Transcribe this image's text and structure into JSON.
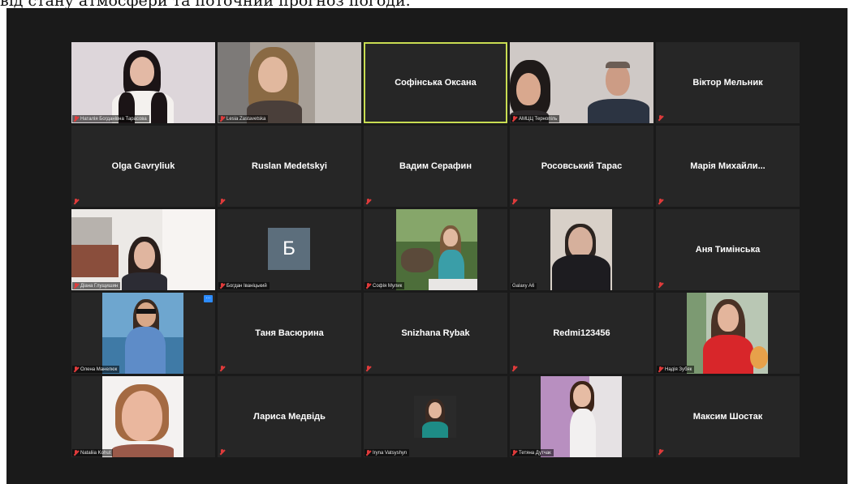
{
  "header_text": "від стану атмосфери та поточний прогноз погоди.",
  "colors": {
    "tile_bg": "#262626",
    "active_speaker_border": "#c8dc52",
    "muted_mic": "#e03b3b"
  },
  "tiles": [
    {
      "name": "Наталія Богданівна Тарасова",
      "type": "video"
    },
    {
      "name": "Lesia Zastavetska",
      "type": "video"
    },
    {
      "name": "Софінська Оксана",
      "type": "name",
      "speaking": true
    },
    {
      "name": "АМЦЦ Тернопіль",
      "type": "video"
    },
    {
      "name": "Віктор Мельник",
      "type": "name"
    },
    {
      "name": "Olga Gavryliuk",
      "type": "name"
    },
    {
      "name": "Ruslan Medetskyi",
      "type": "name"
    },
    {
      "name": "Вадим Серафин",
      "type": "name"
    },
    {
      "name": "Росовський Тарас",
      "type": "name"
    },
    {
      "name": "Марія Михайли...",
      "type": "name"
    },
    {
      "name": "Діана Глущишин",
      "type": "video"
    },
    {
      "name": "Богдан Іваніцький",
      "type": "avatar",
      "initial": "Б"
    },
    {
      "name": "Софія Мулик",
      "type": "photo"
    },
    {
      "name": "Galaxy A6",
      "type": "video"
    },
    {
      "name": "Аня Тимінська",
      "type": "name"
    },
    {
      "name": "Олена Манелюк",
      "type": "photo"
    },
    {
      "name": "Таня Васюрина",
      "type": "name"
    },
    {
      "name": "Snizhana Rybak",
      "type": "name"
    },
    {
      "name": "Redmi123456",
      "type": "name"
    },
    {
      "name": "Надія Зубяк",
      "type": "photo"
    },
    {
      "name": "Nataliia Kohut",
      "type": "photo"
    },
    {
      "name": "Лариса Медвідь",
      "type": "name"
    },
    {
      "name": "Iryna Vatsyshyn",
      "type": "photo"
    },
    {
      "name": "Тетяна Дутчак",
      "type": "photo"
    },
    {
      "name": "Максим Шостак",
      "type": "name"
    }
  ]
}
